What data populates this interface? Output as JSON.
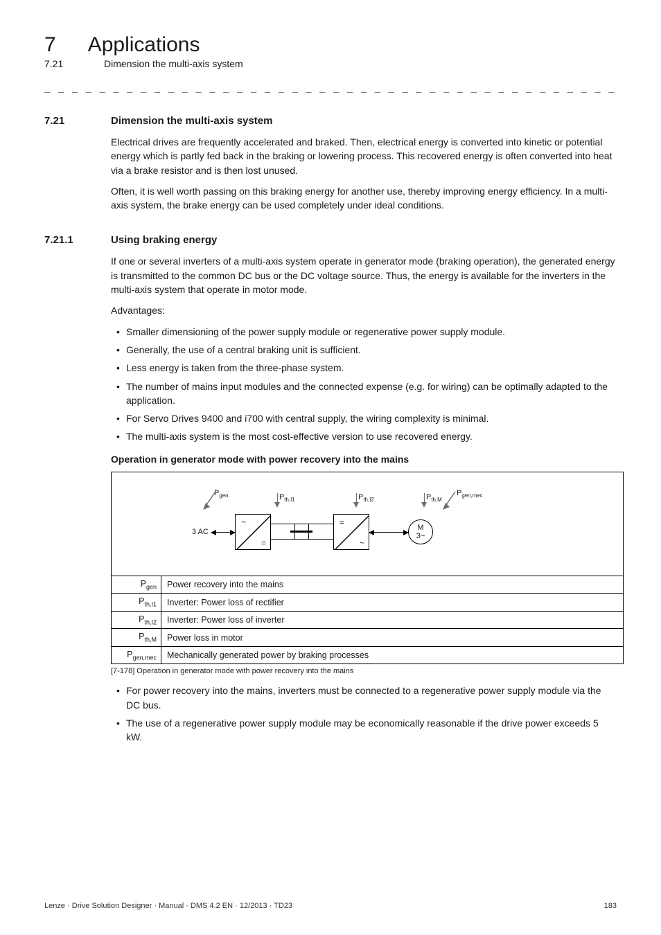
{
  "header": {
    "chapter_num": "7",
    "chapter_title": "Applications",
    "section_num": "7.21",
    "section_title": "Dimension the multi-axis system"
  },
  "dashes": "_ _ _ _ _ _ _ _ _ _ _ _ _ _ _ _ _ _ _ _ _ _ _ _ _ _ _ _ _ _ _ _ _ _ _ _ _ _ _ _ _ _ _ _ _ _ _ _ _ _ _ _ _ _ _ _ _ _ _ _ _ _ _ _",
  "s721": {
    "num": "7.21",
    "title": "Dimension the multi-axis system",
    "p1": "Electrical drives are frequently accelerated and braked. Then, electrical energy is converted into kinetic or potential energy which is partly fed back in the braking or lowering process. This recovered energy is often converted into heat via a brake resistor and is then lost unused.",
    "p2": "Often, it is well worth passing on this braking energy for another use, thereby improving energy efficiency. In a multi-axis system, the brake energy can be used completely under ideal conditions."
  },
  "s7211": {
    "num": "7.21.1",
    "title": "Using braking energy",
    "p1": "If one or several inverters of a multi-axis system operate in generator mode (braking operation), the generated energy is transmitted to the common DC bus or the DC voltage source. Thus, the energy is available for the inverters in the multi-axis system that operate in motor mode.",
    "adv_label": "Advantages:",
    "bullets": [
      "Smaller dimensioning of the power supply module or regenerative power supply module.",
      "Generally, the use of a central braking unit is sufficient.",
      "Less energy is taken from the three-phase system.",
      "The number of mains input modules and the connected expense (e.g. for wiring) can be optimally adapted to the application.",
      "For Servo Drives 9400 and i700 with central supply, the wiring complexity is minimal.",
      "The multi-axis system is the most cost-effective version to use recovered energy."
    ],
    "subhead": "Operation in generator mode with power recovery into the mains"
  },
  "diagram": {
    "ac_label": "3 AC",
    "pgen": "P",
    "pgen_sub": "gen",
    "pthI1": "P",
    "pthI1_sub": "th,I1",
    "pthI2": "P",
    "pthI2_sub": "th,I2",
    "pthM": "P",
    "pthM_sub": "th,M",
    "pgenmec": "P",
    "pgenmec_sub": "gen,mec",
    "motor_line1": "M",
    "motor_line2": "3~",
    "tilde": "~",
    "eq": "="
  },
  "legend": [
    {
      "sym": "P",
      "sub": "gen",
      "desc": "Power recovery into the mains"
    },
    {
      "sym": "P",
      "sub": "th,I1",
      "desc": "Inverter: Power loss of rectifier"
    },
    {
      "sym": "P",
      "sub": "th,I2",
      "desc": "Inverter: Power loss of inverter"
    },
    {
      "sym": "P",
      "sub": "th,M",
      "desc": "Power loss in motor"
    },
    {
      "sym": "P",
      "sub": "gen,mec",
      "desc": "Mechanically generated power by braking processes"
    }
  ],
  "caption": "[7-178] Operation in generator mode with power recovery into the mains",
  "post_bullets": [
    "For power recovery into the mains, inverters must be connected to a regenerative power supply module via the DC bus.",
    "The use of a regenerative power supply module may be economically reasonable if the drive power exceeds 5 kW."
  ],
  "footer": {
    "left": "Lenze · Drive Solution Designer · Manual · DMS 4.2 EN · 12/2013 · TD23",
    "right": "183"
  }
}
